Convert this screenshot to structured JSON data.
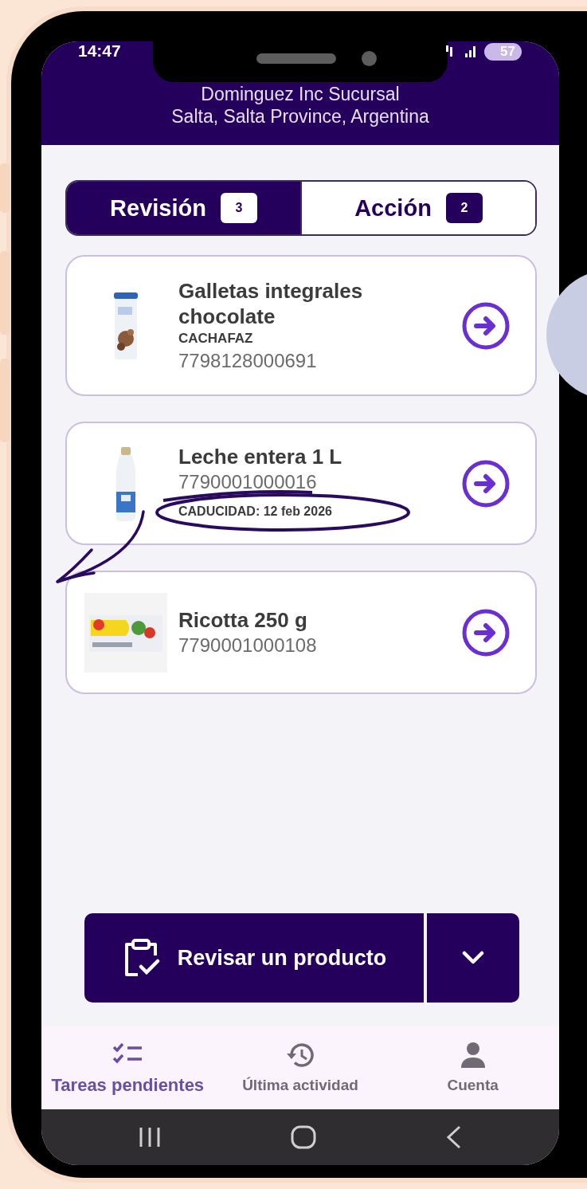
{
  "status_bar": {
    "time": "14:47",
    "battery": "57"
  },
  "header": {
    "store": "Dominguez Inc Sucursal",
    "location": "Salta, Salta Province, Argentina"
  },
  "tabs": [
    {
      "label": "Revisión",
      "count": "3",
      "selected": true
    },
    {
      "label": "Acción",
      "count": "2",
      "selected": false
    }
  ],
  "products": [
    {
      "name": "Galletas integrales chocolate",
      "brand": "CACHAFAZ",
      "code": "7798128000691"
    },
    {
      "name": "Leche entera 1 L",
      "code": "7790001000016",
      "expiry": "CADUCIDAD: 12 feb 2026"
    },
    {
      "name": "Ricotta 250 g",
      "code": "7790001000108"
    }
  ],
  "primary_action": {
    "label": "Revisar un producto"
  },
  "nav": [
    {
      "label": "Tareas pendientes",
      "selected": true
    },
    {
      "label": "Última actividad",
      "selected": false
    },
    {
      "label": "Cuenta",
      "selected": false
    }
  ]
}
